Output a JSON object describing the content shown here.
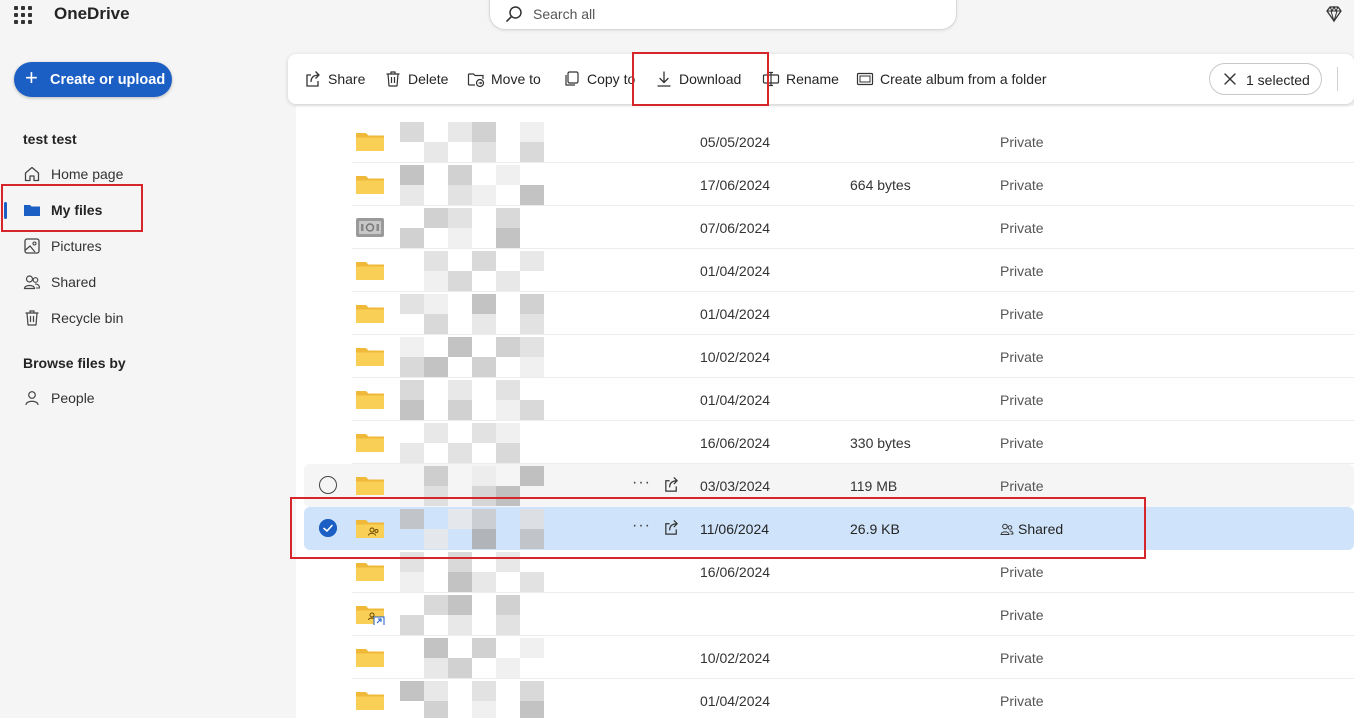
{
  "app": {
    "title": "OneDrive"
  },
  "search": {
    "placeholder": "Search all"
  },
  "sidebar": {
    "create_label": "Create or upload",
    "user_name": "test test",
    "items": [
      {
        "label": "Home page",
        "icon": "home-icon"
      },
      {
        "label": "My files",
        "icon": "folder-icon",
        "active": true
      },
      {
        "label": "Pictures",
        "icon": "pictures-icon"
      },
      {
        "label": "Shared",
        "icon": "people-icon"
      },
      {
        "label": "Recycle bin",
        "icon": "trash-icon"
      }
    ],
    "browse_label": "Browse files by",
    "browse_items": [
      {
        "label": "People",
        "icon": "person-icon"
      }
    ]
  },
  "toolbar": {
    "share": "Share",
    "delete": "Delete",
    "move_to": "Move to",
    "copy_to": "Copy to",
    "download": "Download",
    "rename": "Rename",
    "create_album": "Create album from a folder",
    "selected_count": "1 selected"
  },
  "files": {
    "rows": [
      {
        "date": "05/05/2024",
        "size": "",
        "sharing": "Private",
        "icon": "folder-icon"
      },
      {
        "date": "17/06/2024",
        "size": "664 bytes",
        "sharing": "Private",
        "icon": "folder-icon"
      },
      {
        "date": "07/06/2024",
        "size": "",
        "sharing": "Private",
        "icon": "vault-icon"
      },
      {
        "date": "01/04/2024",
        "size": "",
        "sharing": "Private",
        "icon": "folder-icon"
      },
      {
        "date": "01/04/2024",
        "size": "",
        "sharing": "Private",
        "icon": "folder-icon"
      },
      {
        "date": "10/02/2024",
        "size": "",
        "sharing": "Private",
        "icon": "folder-icon"
      },
      {
        "date": "01/04/2024",
        "size": "",
        "sharing": "Private",
        "icon": "folder-icon"
      },
      {
        "date": "16/06/2024",
        "size": "330 bytes",
        "sharing": "Private",
        "icon": "folder-icon"
      },
      {
        "date": "03/03/2024",
        "size": "119 MB",
        "sharing": "Private",
        "icon": "folder-icon",
        "state": "hover"
      },
      {
        "date": "11/06/2024",
        "size": "26.9 KB",
        "sharing": "Shared",
        "icon": "shared-folder-icon",
        "state": "selected"
      },
      {
        "date": "16/06/2024",
        "size": "",
        "sharing": "Private",
        "icon": "folder-icon"
      },
      {
        "date": "",
        "size": "",
        "sharing": "Private",
        "icon": "shared-folder-shortcut-icon"
      },
      {
        "date": "10/02/2024",
        "size": "",
        "sharing": "Private",
        "icon": "folder-icon"
      },
      {
        "date": "01/04/2024",
        "size": "",
        "sharing": "Private",
        "icon": "folder-icon"
      }
    ],
    "more_label": "···"
  },
  "colors": {
    "accent": "#1b5fc5",
    "selected_row": "#cfe4fa",
    "folder": "#f9c94a",
    "annotation": "#d7262b"
  }
}
